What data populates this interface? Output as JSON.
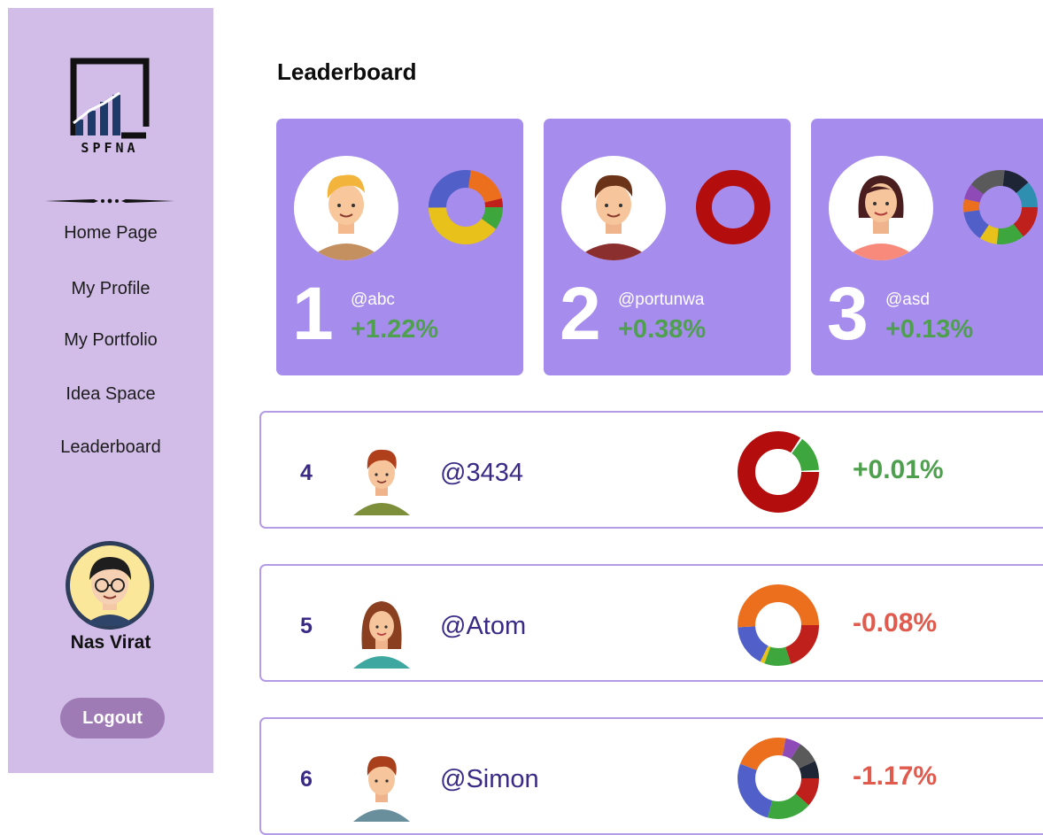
{
  "sidebar": {
    "logo_text": "SPFNA",
    "nav": [
      "Home Page",
      "My Profile",
      "My Portfolio",
      "Idea Space",
      "Leaderboard"
    ],
    "user_name": "Nas Virat",
    "logout_label": "Logout"
  },
  "main": {
    "title": "Leaderboard",
    "top": [
      {
        "rank": "1",
        "username": "@abc",
        "change": "+1.22%",
        "avatar": "blond-man-avatar",
        "donut": [
          "#e8c21a",
          "#5060c8",
          "#ec6f1e",
          "#c0201c",
          "#3da63d"
        ]
      },
      {
        "rank": "2",
        "username": "@portunwa",
        "change": "+0.38%",
        "avatar": "brown-hair-man-avatar",
        "donut": [
          "#b30d0d"
        ]
      },
      {
        "rank": "3",
        "username": "@asd",
        "change": "+0.13%",
        "avatar": "woman-avatar",
        "donut": [
          "#c0201c",
          "#3da63d",
          "#e8c21a",
          "#5060c8",
          "#ec6f1e",
          "#8e4bb8",
          "#555",
          "#222a3a",
          "#2f8fb0"
        ]
      }
    ],
    "rows": [
      {
        "rank": "4",
        "username": "@3434",
        "change": "+0.01%",
        "positive": true,
        "avatar": "boy-avatar"
      },
      {
        "rank": "5",
        "username": "@Atom",
        "change": "-0.08%",
        "positive": false,
        "avatar": "girl-avatar"
      },
      {
        "rank": "6",
        "username": "@Simon",
        "change": "-1.17%",
        "positive": false,
        "avatar": "man-avatar"
      }
    ]
  },
  "colors": {
    "sidebar_bg": "#d2bde8",
    "card_bg": "#a68ced",
    "positive": "#4ea04e",
    "negative": "#e05a4e",
    "accent": "#3a2a86"
  }
}
